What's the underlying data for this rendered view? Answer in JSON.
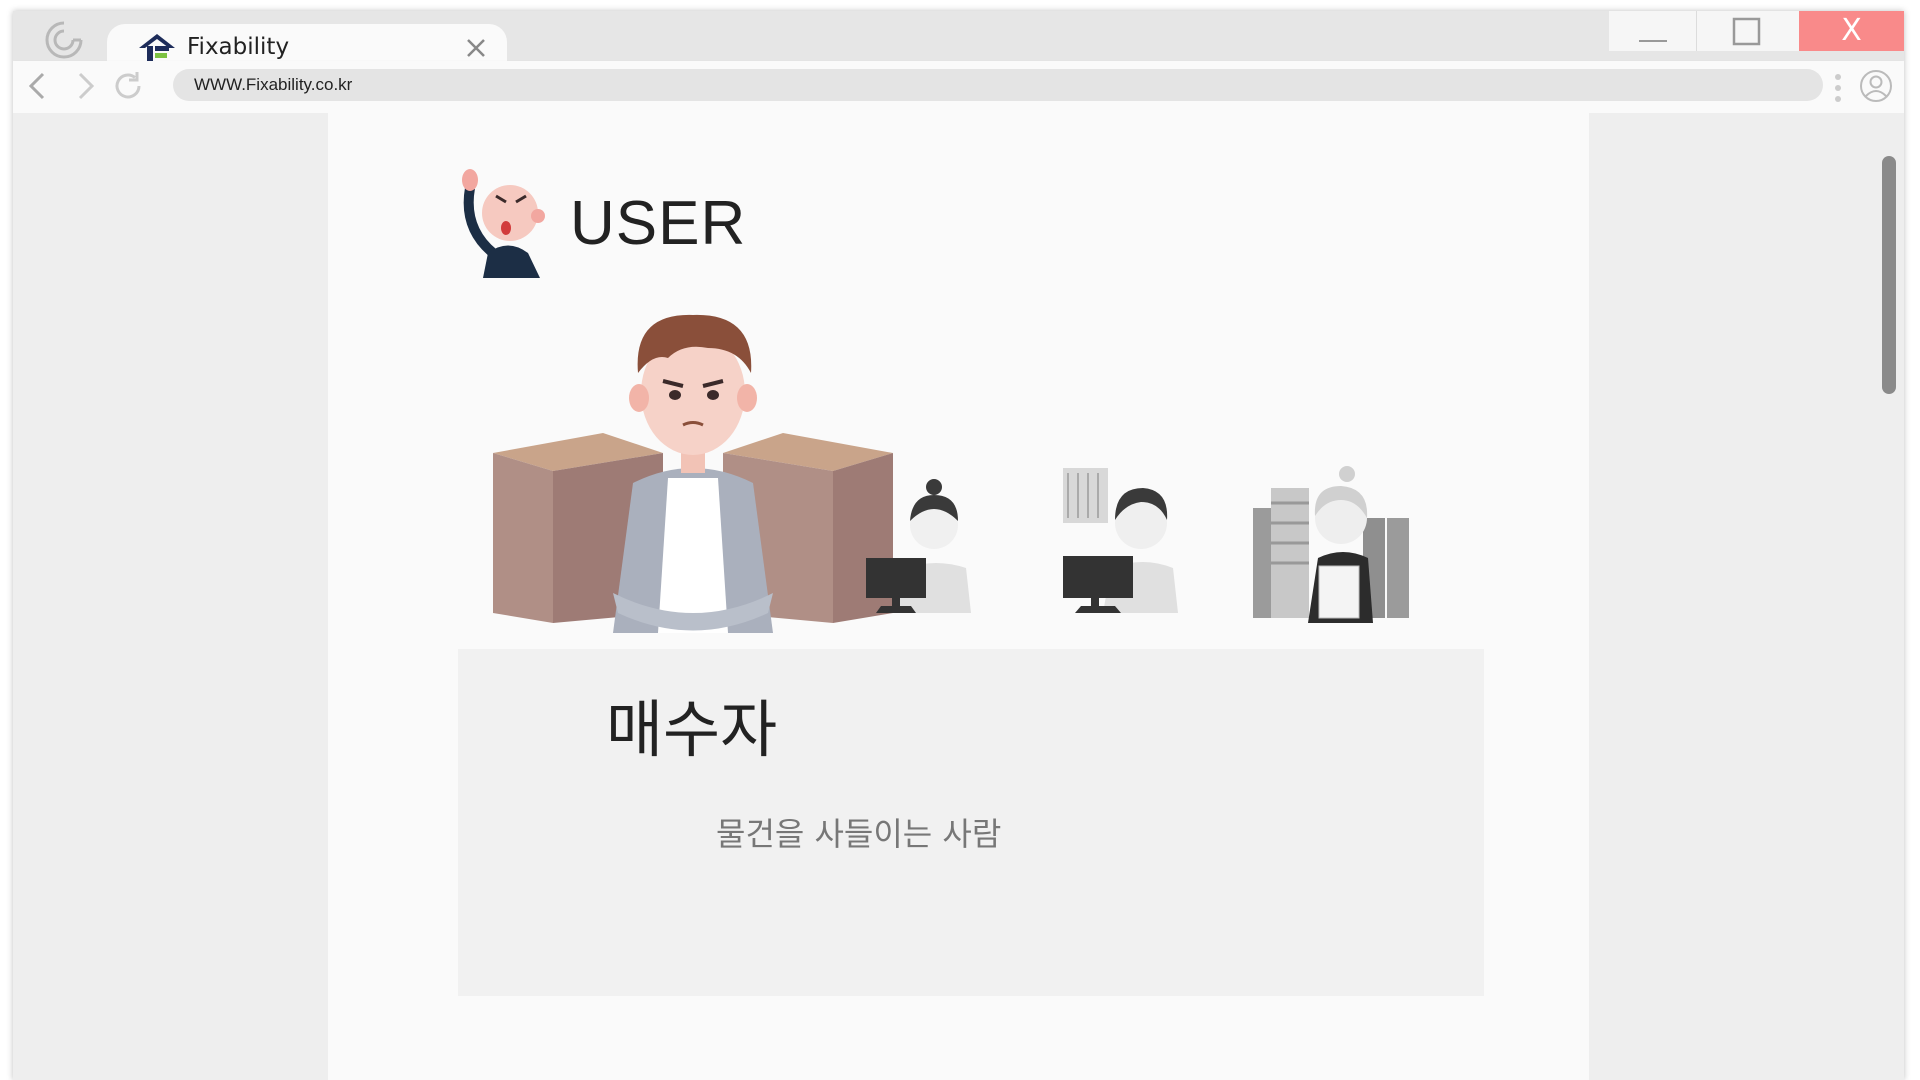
{
  "browser": {
    "tab_title": "Fixability",
    "url": "WWW.Fixability.co.kr",
    "window_close_label": "X"
  },
  "page": {
    "section_heading": "USER",
    "card": {
      "title": "매수자",
      "description": "물건을 사들이는 사람"
    },
    "illustrations": [
      "buyer-character",
      "customer-service-woman",
      "customer-service-man",
      "warehouse-staff"
    ]
  },
  "colors": {
    "window_close": "#f98a8a",
    "brand_dark": "#1d2c5a",
    "brand_green": "#7cc242"
  }
}
